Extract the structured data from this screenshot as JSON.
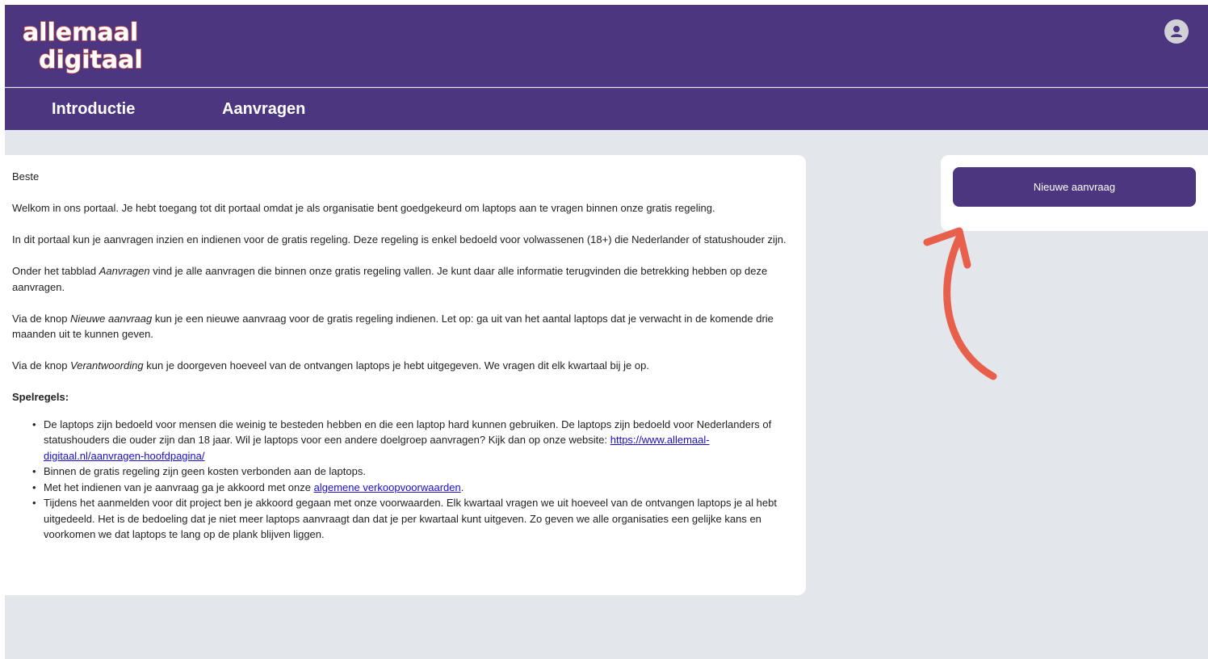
{
  "header": {
    "logo_line1": "allemaal",
    "logo_line2": "digitaal",
    "avatar_icon": "user-avatar-icon"
  },
  "nav": {
    "tabs": [
      "Introductie",
      "Aanvragen"
    ]
  },
  "content": {
    "greeting": "Beste",
    "p1": "Welkom in ons portaal. Je hebt toegang tot dit portaal omdat je als organisatie bent goedgekeurd om laptops aan te vragen binnen onze gratis regeling.",
    "p2": "In dit portaal kun je aanvragen inzien en indienen voor de gratis regeling. Deze regeling is enkel bedoeld voor volwassenen (18+) die Nederlander of statushouder zijn.",
    "p3_a": "Onder het tabblad ",
    "p3_em": "Aanvragen",
    "p3_b": " vind je alle aanvragen die binnen onze gratis regeling vallen. Je kunt daar alle informatie terugvinden die betrekking hebben op deze aanvragen.",
    "p4_a": "Via de knop ",
    "p4_em": "Nieuwe aanvraag",
    "p4_b": " kun je een nieuwe aanvraag voor de gratis regeling indienen. Let op: ga uit van het aantal laptops dat je verwacht in de komende drie maanden uit te kunnen geven.",
    "p5_a": "Via de knop ",
    "p5_em": "Verantwoording",
    "p5_b": " kun je doorgeven hoeveel van de ontvangen laptops je hebt uitgegeven. We vragen dit elk kwartaal bij je op.",
    "rules_title": "Spelregels:",
    "rule1_text": "De laptops zijn bedoeld voor mensen die weinig te besteden hebben en die een laptop hard kunnen gebruiken. De laptops zijn bedoeld voor Nederlanders of statushouders die ouder zijn dan 18 jaar. Wil je laptops voor een andere doelgroep aanvragen? Kijk dan op onze website: ",
    "rule1_link": "https://www.allemaal-digitaal.nl/aanvragen-hoofdpagina/",
    "rule2": "Binnen de gratis regeling zijn geen kosten verbonden aan de laptops.",
    "rule3_text": "Met het indienen van je aanvraag ga je akkoord met onze ",
    "rule3_link": "algemene verkoopvoorwaarden",
    "rule3_end": ".",
    "rule4": "Tijdens het aanmelden voor dit project ben je akkoord gegaan met onze voorwaarden. Elk kwartaal vragen we uit hoeveel van de ontvangen laptops je al hebt uitgedeeld. Het is de bedoeling dat je niet meer laptops aanvraagt dan dat je per kwartaal kunt uitgeven. Zo geven we alle organisaties een gelijke kans en voorkomen we dat laptops te lang op de plank blijven liggen."
  },
  "sidebar": {
    "new_request_label": "Nieuwe aanvraag"
  },
  "colors": {
    "brand_purple": "#4b367f",
    "arrow": "#e8604c",
    "background": "#e3e6ea"
  }
}
